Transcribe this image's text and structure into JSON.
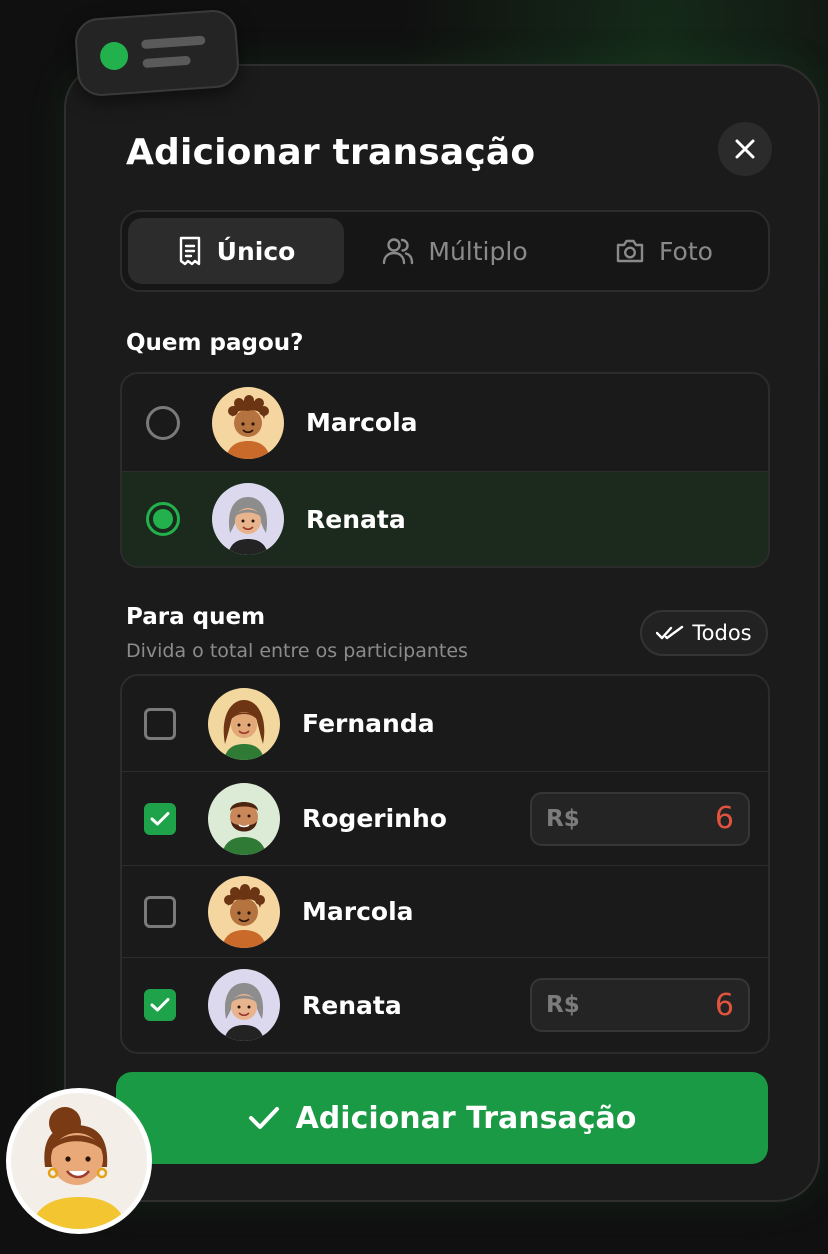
{
  "modal": {
    "title": "Adicionar transação",
    "close_icon": "close-icon"
  },
  "tabs": [
    {
      "label": "Único",
      "icon": "receipt-icon",
      "active": true
    },
    {
      "label": "Múltiplo",
      "icon": "users-icon",
      "active": false
    },
    {
      "label": "Foto",
      "icon": "camera-icon",
      "active": false
    }
  ],
  "payer": {
    "heading": "Quem pagou?",
    "options": [
      {
        "name": "Marcola",
        "selected": false
      },
      {
        "name": "Renata",
        "selected": true
      }
    ]
  },
  "split": {
    "heading": "Para quem",
    "subheading": "Divida o total entre os participantes",
    "all_button": "Todos",
    "participants": [
      {
        "name": "Fernanda",
        "checked": false
      },
      {
        "name": "Rogerinho",
        "checked": true,
        "currency": "R$",
        "amount": "6"
      },
      {
        "name": "Marcola",
        "checked": false
      },
      {
        "name": "Renata",
        "checked": true,
        "currency": "R$",
        "amount": "6"
      }
    ]
  },
  "submit": {
    "label": "Adicionar Transação"
  },
  "colors": {
    "accent": "#22b14c",
    "amount": "#e2533f",
    "background": "#1b1b1b"
  }
}
